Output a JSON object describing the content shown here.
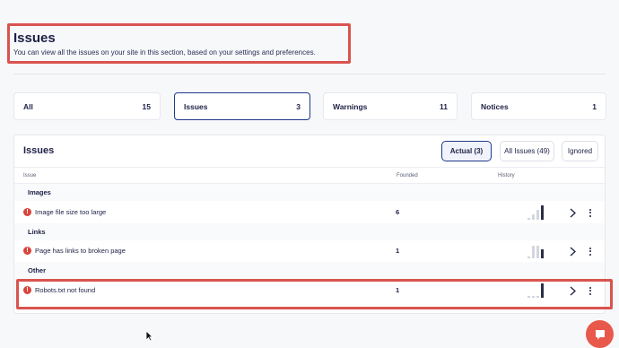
{
  "header": {
    "title": "Issues",
    "subtitle": "You can view all the issues on your site in this section, based on your settings and preferences."
  },
  "stats": [
    {
      "label": "All",
      "count": "15",
      "active": false
    },
    {
      "label": "Issues",
      "count": "3",
      "active": true
    },
    {
      "label": "Warnings",
      "count": "11",
      "active": false
    },
    {
      "label": "Notices",
      "count": "1",
      "active": false
    }
  ],
  "panel": {
    "title": "Issues",
    "filters": [
      {
        "label": "Actual (3)",
        "active": true
      },
      {
        "label": "All Issues (49)",
        "active": false
      },
      {
        "label": "Ignored",
        "active": false
      }
    ],
    "columns": {
      "issue": "Issue",
      "founded": "Founded",
      "history": "History"
    },
    "groups": [
      {
        "label": "Images",
        "rows": [
          {
            "name": "Image file size too large",
            "count": "6",
            "history": [
              0.1,
              0.35,
              0.7,
              1.0
            ]
          }
        ]
      },
      {
        "label": "Links",
        "rows": [
          {
            "name": "Page has links to broken page",
            "count": "1",
            "history": [
              0.1,
              0.9,
              0.9,
              0.6
            ]
          }
        ]
      },
      {
        "label": "Other",
        "rows": [
          {
            "name": "Robots.txt not found",
            "count": "1",
            "history": [
              0.1,
              0.1,
              0.1,
              1.0
            ]
          }
        ]
      }
    ]
  },
  "icons": {
    "error": "exclamation-circle-icon",
    "chevron": "chevron-right-icon",
    "more": "more-vertical-icon",
    "chat": "chat-bubble-icon"
  },
  "colors": {
    "accent": "#1e3a8a",
    "error": "#d9443a",
    "highlight": "#d9534f",
    "chat": "#e8584b"
  }
}
